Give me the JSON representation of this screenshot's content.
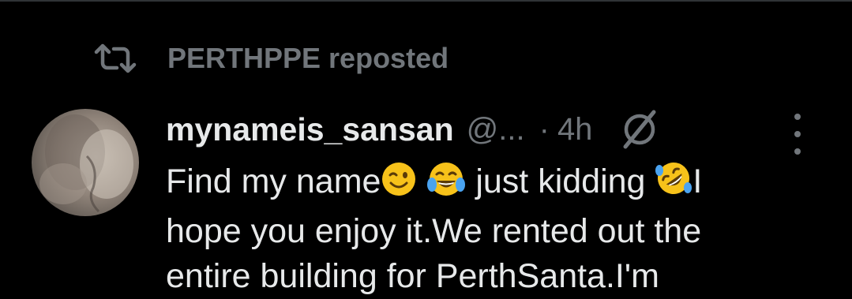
{
  "repost": {
    "icon": "repost-icon",
    "reposter_name": "PERTHPPE",
    "suffix": " reposted"
  },
  "tweet": {
    "display_name": "mynameis_sansan",
    "handle": "@...",
    "separator": "·",
    "time": "4h",
    "grok_icon": "grok-icon",
    "more_icon": "more-icon",
    "lines": [
      {
        "before_emoji": "Find my name",
        "emoji1": "wink-emoji",
        "emoji2": "tears-of-joy-emoji",
        "middle": " just kidding ",
        "emoji3": "rofl-emoji",
        "after_emoji": "I"
      },
      {
        "text": "hope you enjoy it.We rented out the"
      },
      {
        "text": "entire building for PerthSanta.I'm"
      }
    ]
  },
  "colors": {
    "background": "#000000",
    "primary_text": "#e7e9ea",
    "secondary_text": "#71767b",
    "divider": "#2f3336"
  }
}
